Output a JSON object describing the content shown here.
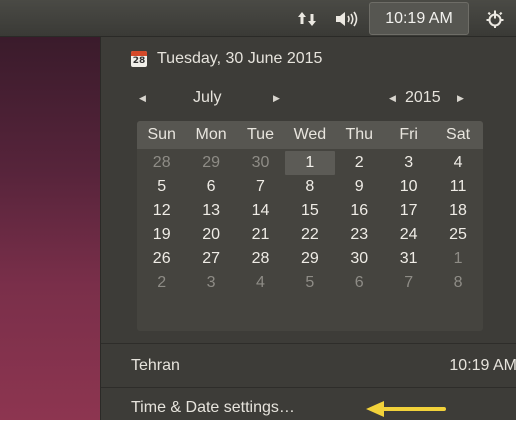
{
  "panel": {
    "network_icon": "network-updown-icon",
    "sound_icon": "speaker-volume-icon",
    "clock": "10:19 AM",
    "power_icon": "power-gear-icon"
  },
  "menu": {
    "date_header": "Tuesday, 30 June 2015",
    "calendar_icon_day": "28",
    "month": "July",
    "year": "2015",
    "weekdays": [
      "Sun",
      "Mon",
      "Tue",
      "Wed",
      "Thu",
      "Fri",
      "Sat"
    ],
    "weeks": [
      [
        "28",
        "29",
        "30",
        "1",
        "2",
        "3",
        "4"
      ],
      [
        "5",
        "6",
        "7",
        "8",
        "9",
        "10",
        "11"
      ],
      [
        "12",
        "13",
        "14",
        "15",
        "16",
        "17",
        "18"
      ],
      [
        "19",
        "20",
        "21",
        "22",
        "23",
        "24",
        "25"
      ],
      [
        "26",
        "27",
        "28",
        "29",
        "30",
        "31",
        "1"
      ],
      [
        "2",
        "3",
        "4",
        "5",
        "6",
        "7",
        "8"
      ]
    ],
    "location_name": "Tehran",
    "location_time": "10:19 AM",
    "settings_label": "Time & Date settings…"
  },
  "colors": {
    "panel_bg": "#3f3f3b",
    "menu_bg": "#3d3c38",
    "annotation_arrow": "#f2d23a"
  }
}
